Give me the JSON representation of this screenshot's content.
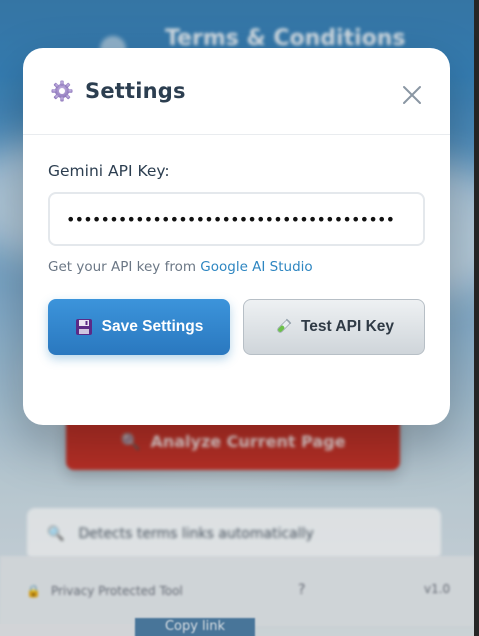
{
  "background": {
    "header_title": "Terms & Conditions",
    "analyze_button": "Analyze Current Page",
    "feature_text": "Detects terms links automatically",
    "footer_left": "Privacy Protected Tool",
    "footer_help": "?",
    "footer_version": "v1.0",
    "copy_link": "Copy link"
  },
  "modal": {
    "title": "Settings",
    "title_icon": "gear-icon",
    "close_icon": "close-icon",
    "api_key_label": "Gemini API Key:",
    "api_key_value": "••••••••••••••••••••••••••••••••••••••",
    "hint_text": "Get your API key from ",
    "hint_link": "Google AI Studio",
    "save_button": {
      "label": "Save Settings",
      "icon": "floppy-disk-icon"
    },
    "test_button": {
      "label": "Test API Key",
      "icon": "test-tube-icon"
    }
  },
  "colors": {
    "primary": "#2e86c1",
    "title_text": "#2c3e50",
    "hint_text": "#6b7785"
  }
}
